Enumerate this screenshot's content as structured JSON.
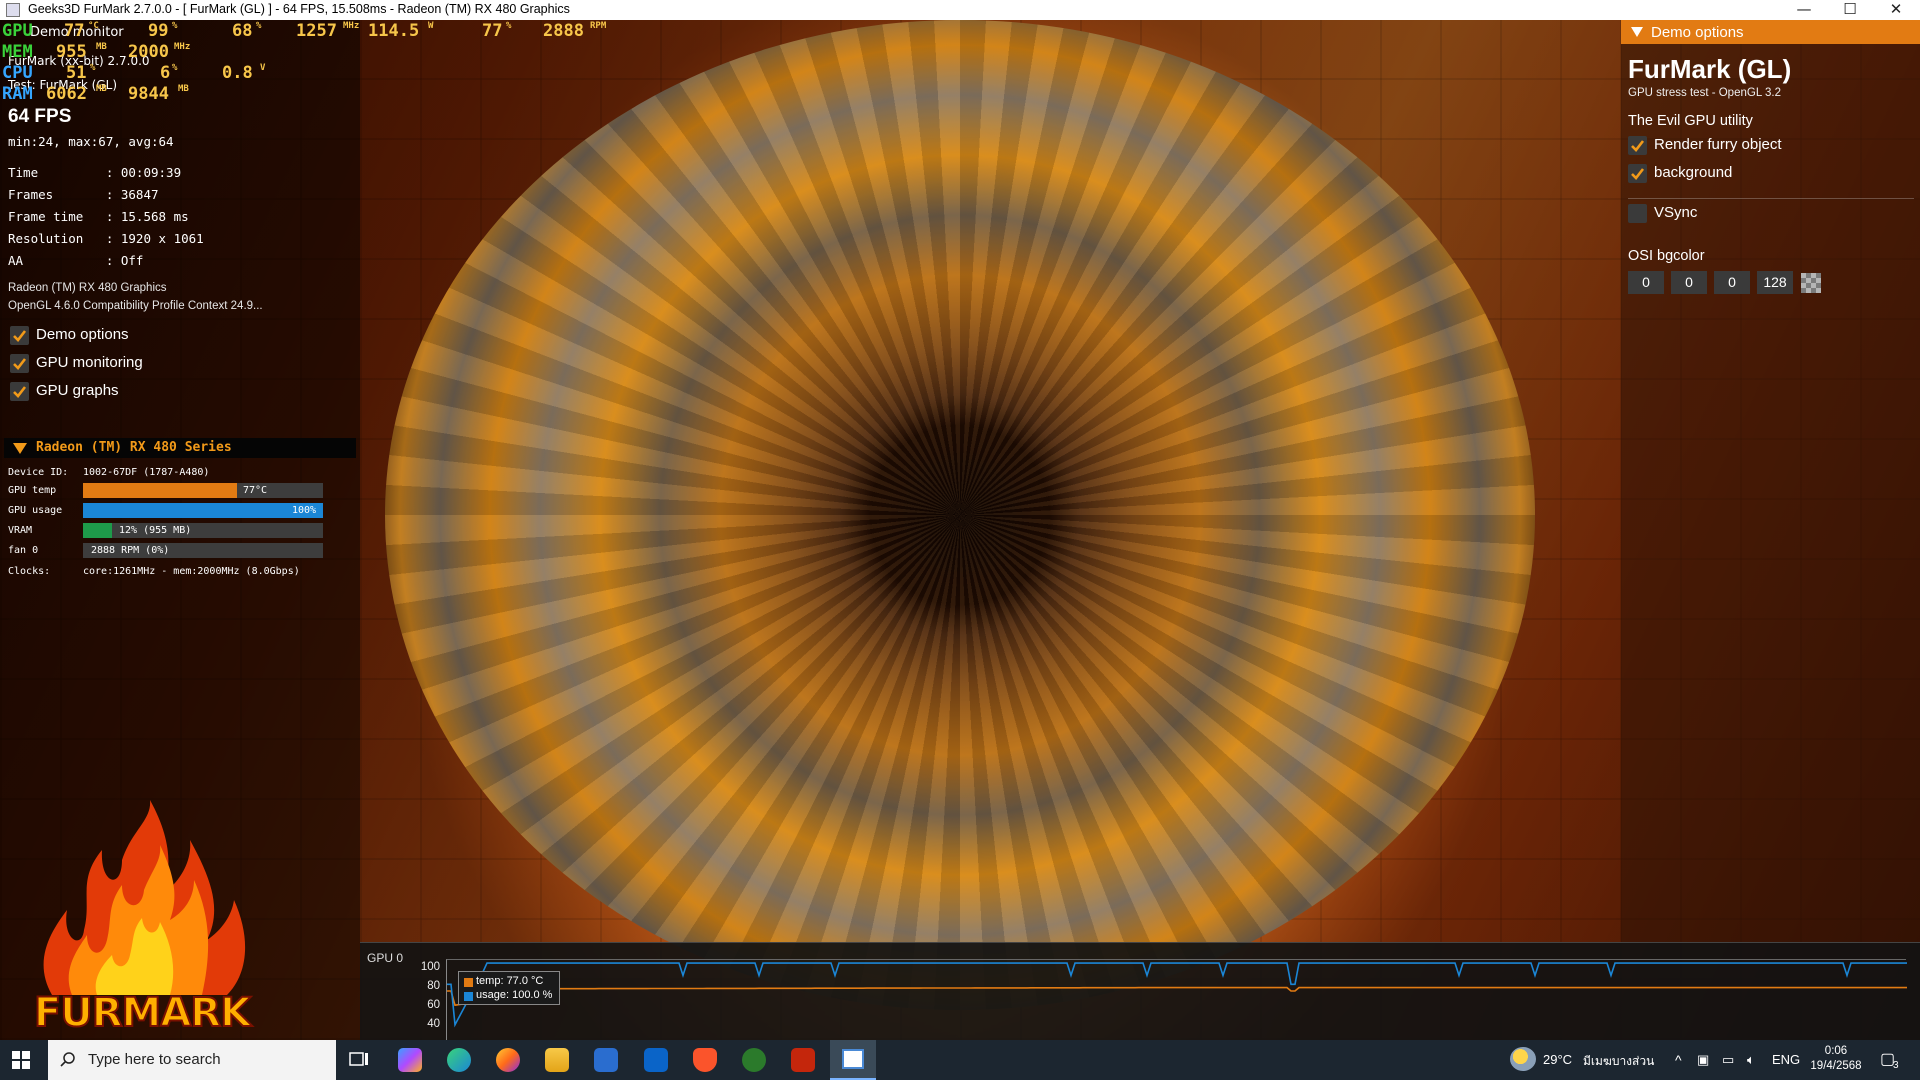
{
  "window": {
    "title": "Geeks3D FurMark 2.7.0.0 - [ FurMark (GL) ] - 64 FPS, 15.508ms - Radeon (TM) RX 480 Graphics",
    "minimize": "—",
    "maximize": "☐",
    "close": "✕"
  },
  "osd": {
    "gpu_key": "GPU",
    "mem_key": "MEM",
    "cpu_key": "CPU",
    "ram_key": "RAM",
    "gpu_temp": "77",
    "gpu_temp_unit": "°C",
    "gpu_usage": "99",
    "gpu_usage_unit": "%",
    "gpu_x": "68",
    "gpu_x_unit": "%",
    "gpu_clock": "1257",
    "gpu_clock_unit": "MHz",
    "gpu_power": "114.5",
    "gpu_power_unit": "W",
    "gpu_fan_pct": "77",
    "gpu_fan_pct_unit": "%",
    "gpu_fan_rpm": "2888",
    "gpu_fan_rpm_unit": "RPM",
    "mem_used": "955",
    "mem_used_unit": "MB",
    "mem_clock": "2000",
    "mem_clock_unit": "MHz",
    "cpu_usage": "51",
    "cpu_usage_unit": "%",
    "cpu_x": "6",
    "cpu_x_unit": "%",
    "cpu_volt": "0.8",
    "cpu_volt_unit": "V",
    "ram_used": "6062",
    "ram_used_unit": "MB",
    "ram_total": "9844",
    "ram_total_unit": "MB",
    "under_demo_monitor": "Demo monitor",
    "under_furmark": "FurMark (xx-bit) 2.7.0.0",
    "under_test": "Test: FurMark (GL)"
  },
  "stats": {
    "fps": "64 FPS",
    "fps_detail": "min:24, max:67, avg:64",
    "time": "Time         : 00:09:39",
    "frames": "Frames       : 36847",
    "frame_time": "Frame time   : 15.568 ms",
    "resolution": "Resolution   : 1920 x 1061",
    "aa": "AA           : Off",
    "gpu_name": "Radeon (TM) RX 480 Graphics",
    "gl_context": "OpenGL 4.6.0 Compatibility Profile Context 24.9..."
  },
  "left_options": [
    {
      "label": "Demo options",
      "checked": true
    },
    {
      "label": "GPU monitoring",
      "checked": true
    },
    {
      "label": "GPU graphs",
      "checked": true
    }
  ],
  "gpu_monitor": {
    "header": "Radeon (TM) RX 480 Series",
    "device_id_label": "Device ID:",
    "device_id": "1002-67DF (1787-A480)",
    "rows": [
      {
        "label": "GPU temp",
        "text": "77°C",
        "fraction": 0.64,
        "color": "#e27b13"
      },
      {
        "label": "GPU usage",
        "text": "100%",
        "fraction": 1.0,
        "color": "#1b86d6"
      },
      {
        "label": "VRAM",
        "text": "12% (955 MB)",
        "fraction": 0.12,
        "color": "#1e9a4a"
      },
      {
        "label": "fan 0",
        "text": "2888 RPM (0%)",
        "fraction": 0.0,
        "color": "#3d3d3d"
      }
    ],
    "clocks_label": "Clocks:",
    "clocks": "core:1261MHz - mem:2000MHz (8.0Gbps)"
  },
  "logo_text": "FURMARK",
  "demo_options_panel": {
    "header": "Demo options",
    "title": "FurMark (GL)",
    "subtitle": "GPU stress test - OpenGL 3.2",
    "tagline": "The Evil GPU utility",
    "render_furry": {
      "label": "Render furry object",
      "checked": true
    },
    "background": {
      "label": "background",
      "checked": true
    },
    "vsync": {
      "label": "VSync",
      "checked": false
    },
    "osi_label": "OSI bgcolor",
    "osi_values": [
      "0",
      "0",
      "0",
      "128"
    ]
  },
  "graph": {
    "title": "GPU 0",
    "ticks": [
      "100",
      "80",
      "60",
      "40"
    ],
    "legend_temp": "temp: 77.0 °C",
    "legend_usage": "usage: 100.0 %",
    "temp_color": "#e27b13",
    "usage_color": "#1b86d6"
  },
  "taskbar": {
    "search_placeholder": "Type here to search",
    "weather": "29°C",
    "weather_desc": "มีเมฆบางส่วน",
    "lang": "ENG",
    "time": "0:06",
    "date": "19/4/2568",
    "notifications": "3"
  }
}
